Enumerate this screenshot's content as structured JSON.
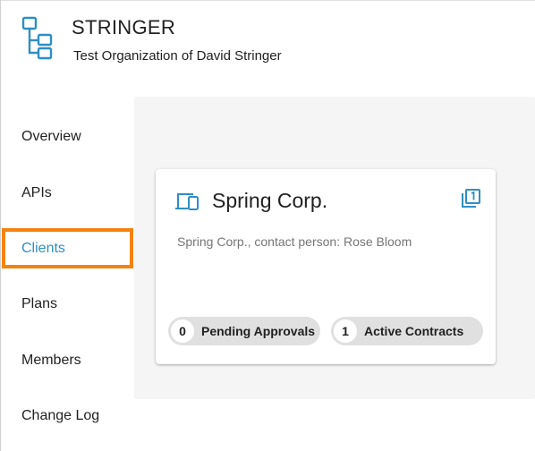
{
  "organization": {
    "name": "STRINGER",
    "description": "Test Organization of David Stringer",
    "icon": "org-tree-icon"
  },
  "nav": {
    "items": [
      {
        "label": "Overview",
        "active": false
      },
      {
        "label": "APIs",
        "active": false
      },
      {
        "label": "Clients",
        "active": true
      },
      {
        "label": "Plans",
        "active": false
      },
      {
        "label": "Members",
        "active": false
      },
      {
        "label": "Change Log",
        "active": false
      }
    ]
  },
  "client_card": {
    "name": "Spring Corp.",
    "description": "Spring Corp., contact person: Rose Bloom",
    "icon": "devices-icon",
    "version_icon": "filter-1-icon",
    "pending_approvals": {
      "count": "0",
      "label": "Pending Approvals"
    },
    "active_contracts": {
      "count": "1",
      "label": "Active Contracts"
    }
  },
  "colors": {
    "accent": "#2e8ec6",
    "highlight": "#f5820f",
    "chip": "#e0e0e0"
  }
}
